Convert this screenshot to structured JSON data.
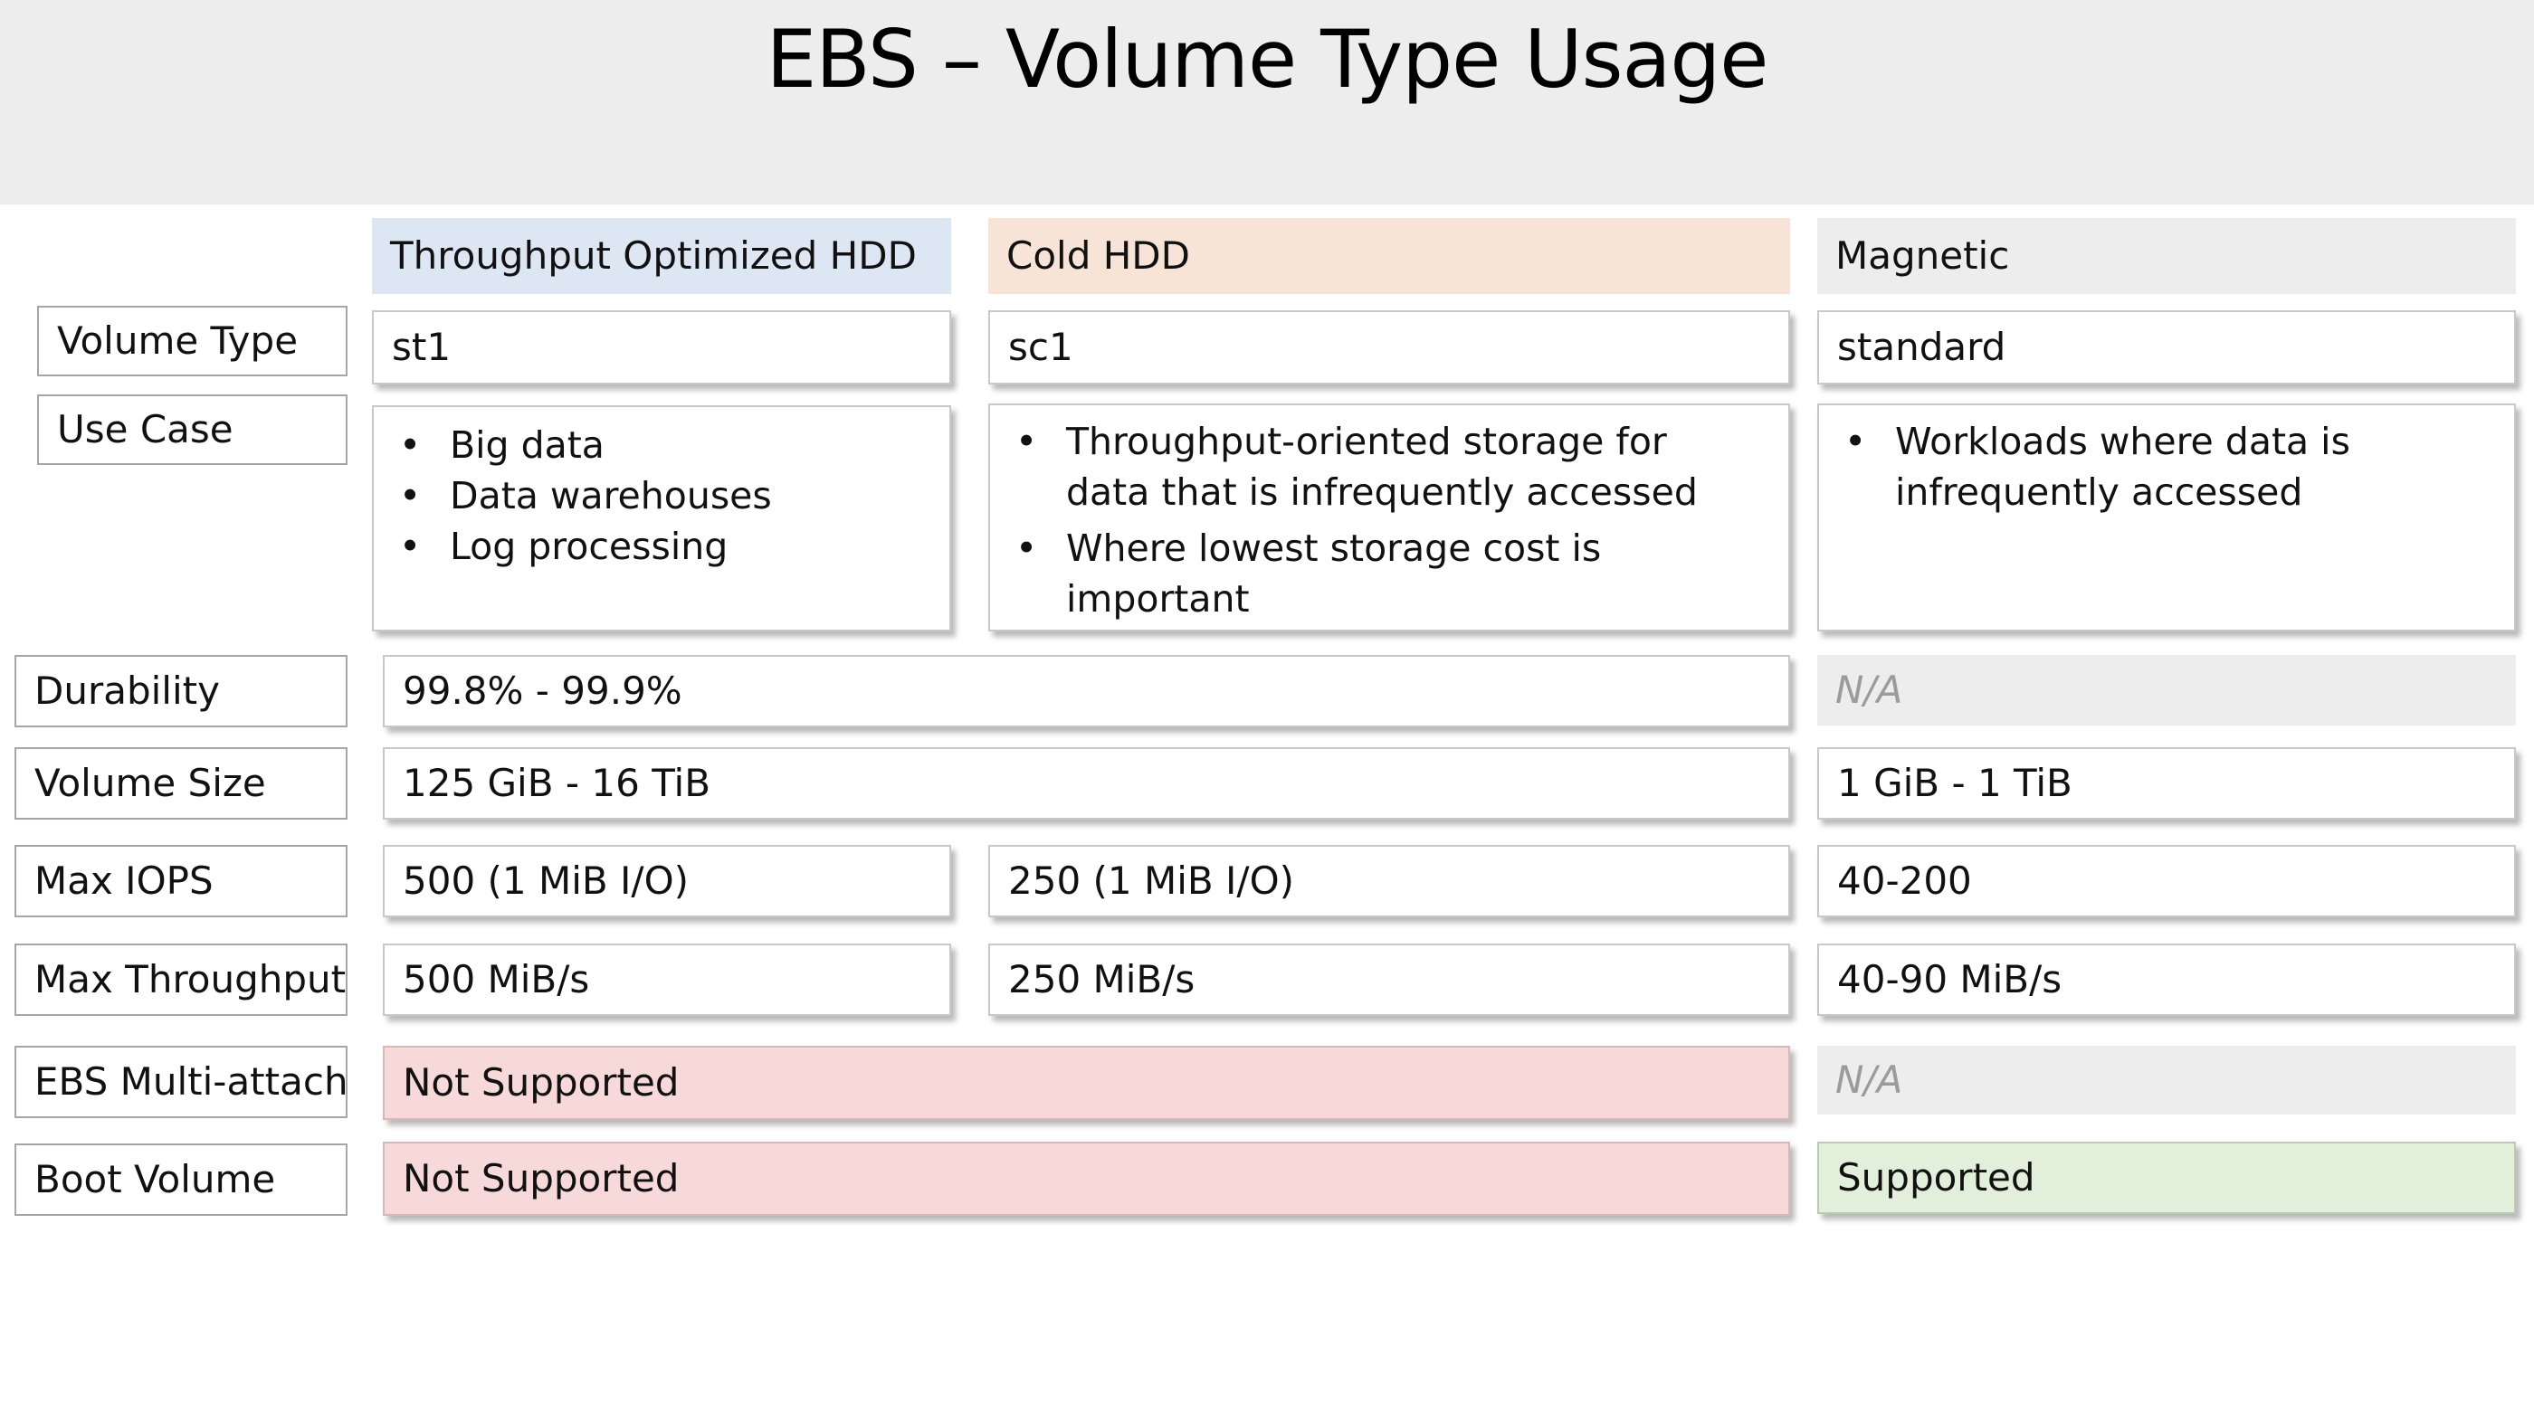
{
  "title": "EBS – Volume Type Usage",
  "columns": {
    "st1_header": "Throughput Optimized HDD",
    "sc1_header": "Cold HDD",
    "magnetic_header": "Magnetic"
  },
  "row_labels": {
    "volume_type": "Volume Type",
    "use_case": "Use Case",
    "durability": "Durability",
    "volume_size": "Volume Size",
    "max_iops": "Max IOPS",
    "max_throughput": "Max Throughput",
    "multi_attach": "EBS Multi-attach",
    "boot_volume": "Boot Volume"
  },
  "volume_type": {
    "st1": "st1",
    "sc1": "sc1",
    "magnetic": "standard"
  },
  "use_case": {
    "st1": [
      "Big data",
      "Data warehouses",
      "Log processing"
    ],
    "sc1": [
      "Throughput-oriented storage for data that is infrequently accessed",
      "Where lowest storage cost is important"
    ],
    "magnetic": [
      "Workloads where data is infrequently accessed"
    ]
  },
  "durability": {
    "hdd": "99.8% - 99.9%",
    "magnetic": "N/A"
  },
  "volume_size": {
    "hdd": "125 GiB - 16 TiB",
    "magnetic": "1 GiB - 1 TiB"
  },
  "max_iops": {
    "st1": "500 (1 MiB I/O)",
    "sc1": "250 (1 MiB I/O)",
    "magnetic": "40-200"
  },
  "max_throughput": {
    "st1": "500 MiB/s",
    "sc1": "250 MiB/s",
    "magnetic": "40-90 MiB/s"
  },
  "multi_attach": {
    "hdd": "Not Supported",
    "magnetic": "N/A"
  },
  "boot_volume": {
    "hdd": "Not Supported",
    "magnetic": "Supported"
  },
  "colors": {
    "header_band": "#ededed",
    "st1_header": "#dde7f4",
    "sc1_header": "#f8e4d7",
    "magnetic_header": "#ededed",
    "not_supported": "#f8d9d9",
    "supported": "#e2efda",
    "na_text": "#9b9b9b"
  }
}
